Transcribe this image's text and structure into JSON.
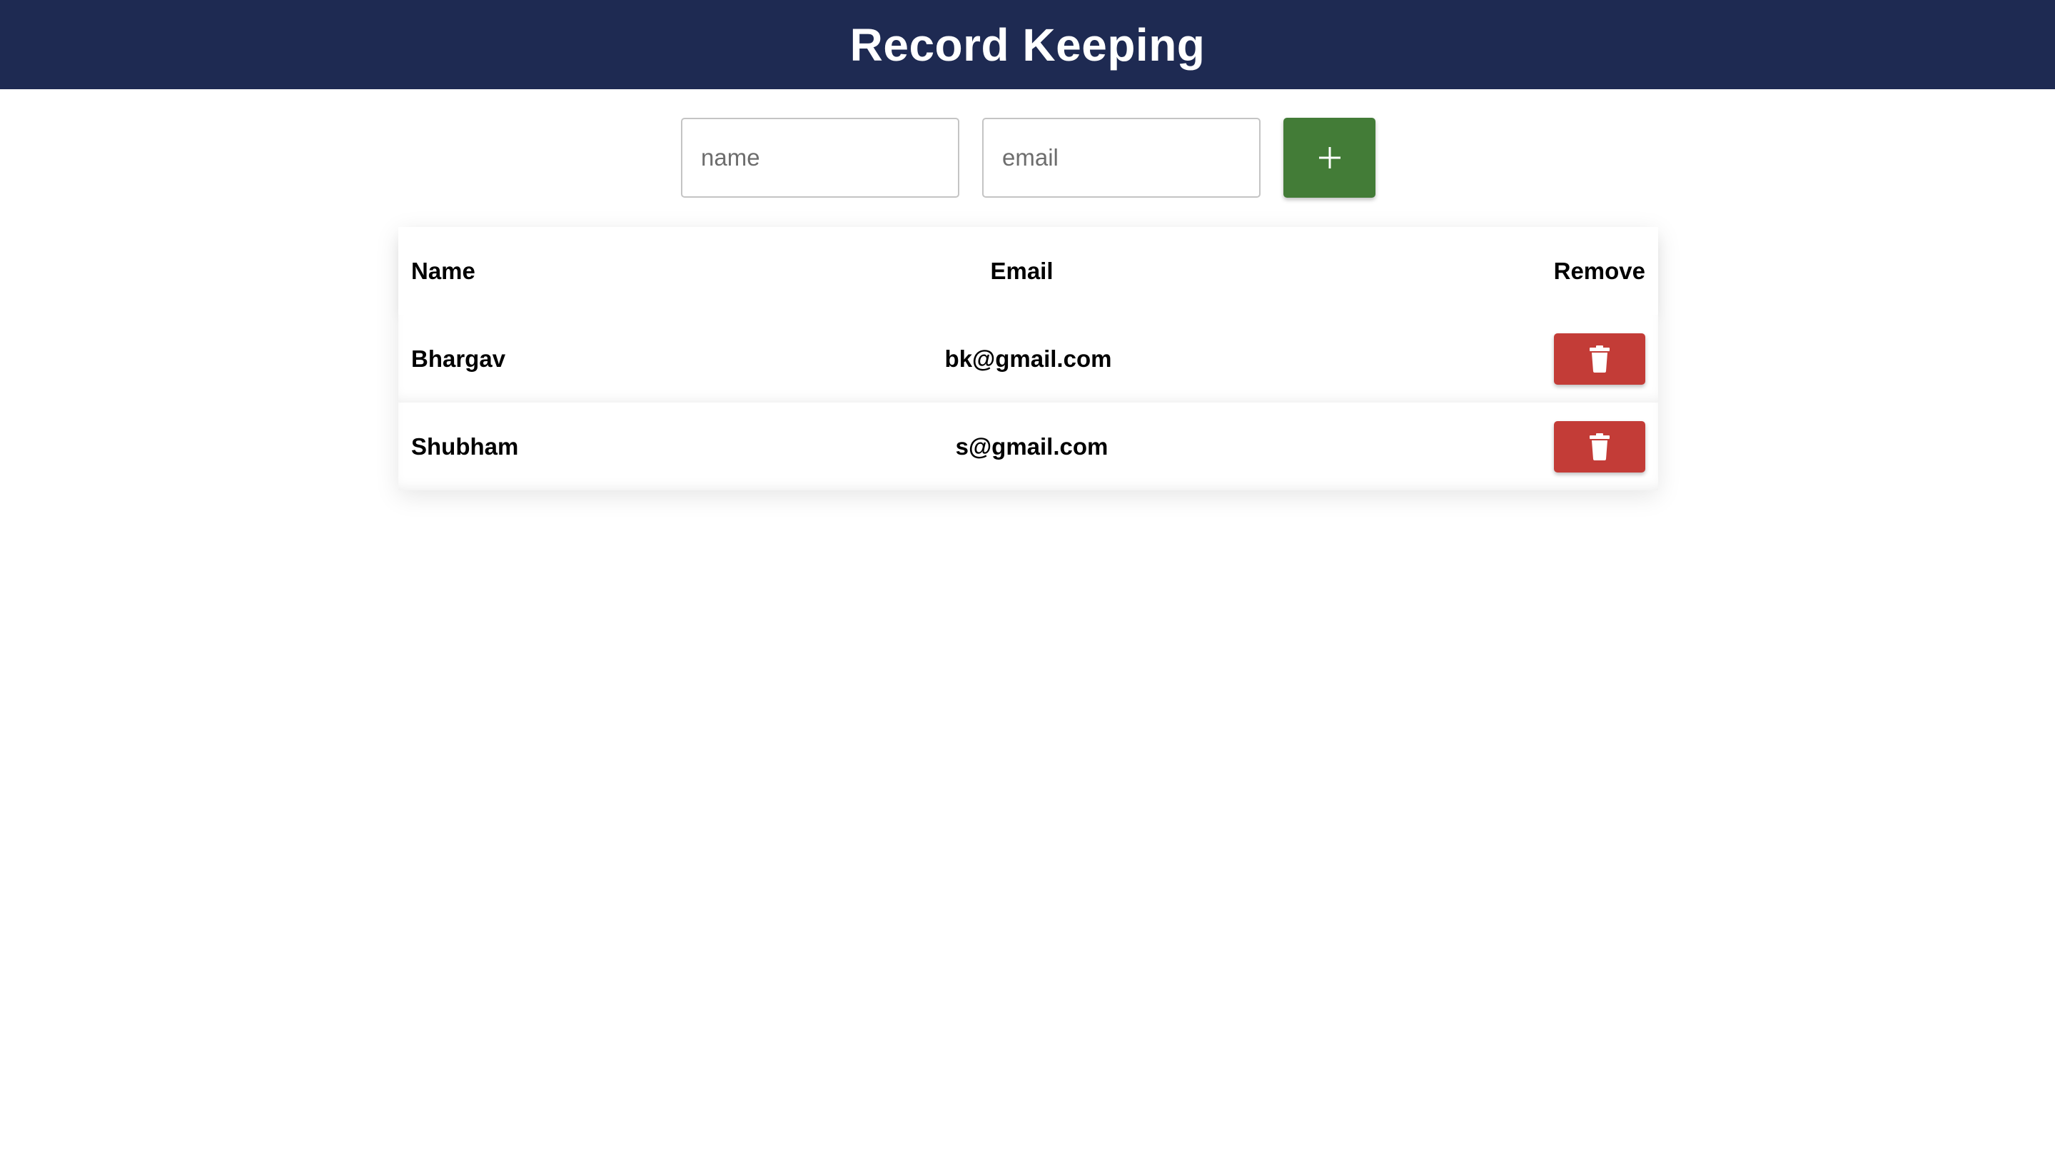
{
  "header": {
    "title": "Record Keeping",
    "background_color": "#1e2a52"
  },
  "form": {
    "name_placeholder": "name",
    "name_value": "",
    "email_placeholder": "email",
    "email_value": "",
    "add_icon": "plus-icon",
    "add_button_color": "#437c37"
  },
  "table": {
    "columns": [
      "Name",
      "Email",
      "Remove"
    ],
    "rows": [
      {
        "name": "Bhargav",
        "email": "bk@gmail.com",
        "remove_icon": "trash-icon"
      },
      {
        "name": "Shubham",
        "email": "s@gmail.com",
        "remove_icon": "trash-icon"
      }
    ],
    "remove_button_color": "#c33c37"
  }
}
